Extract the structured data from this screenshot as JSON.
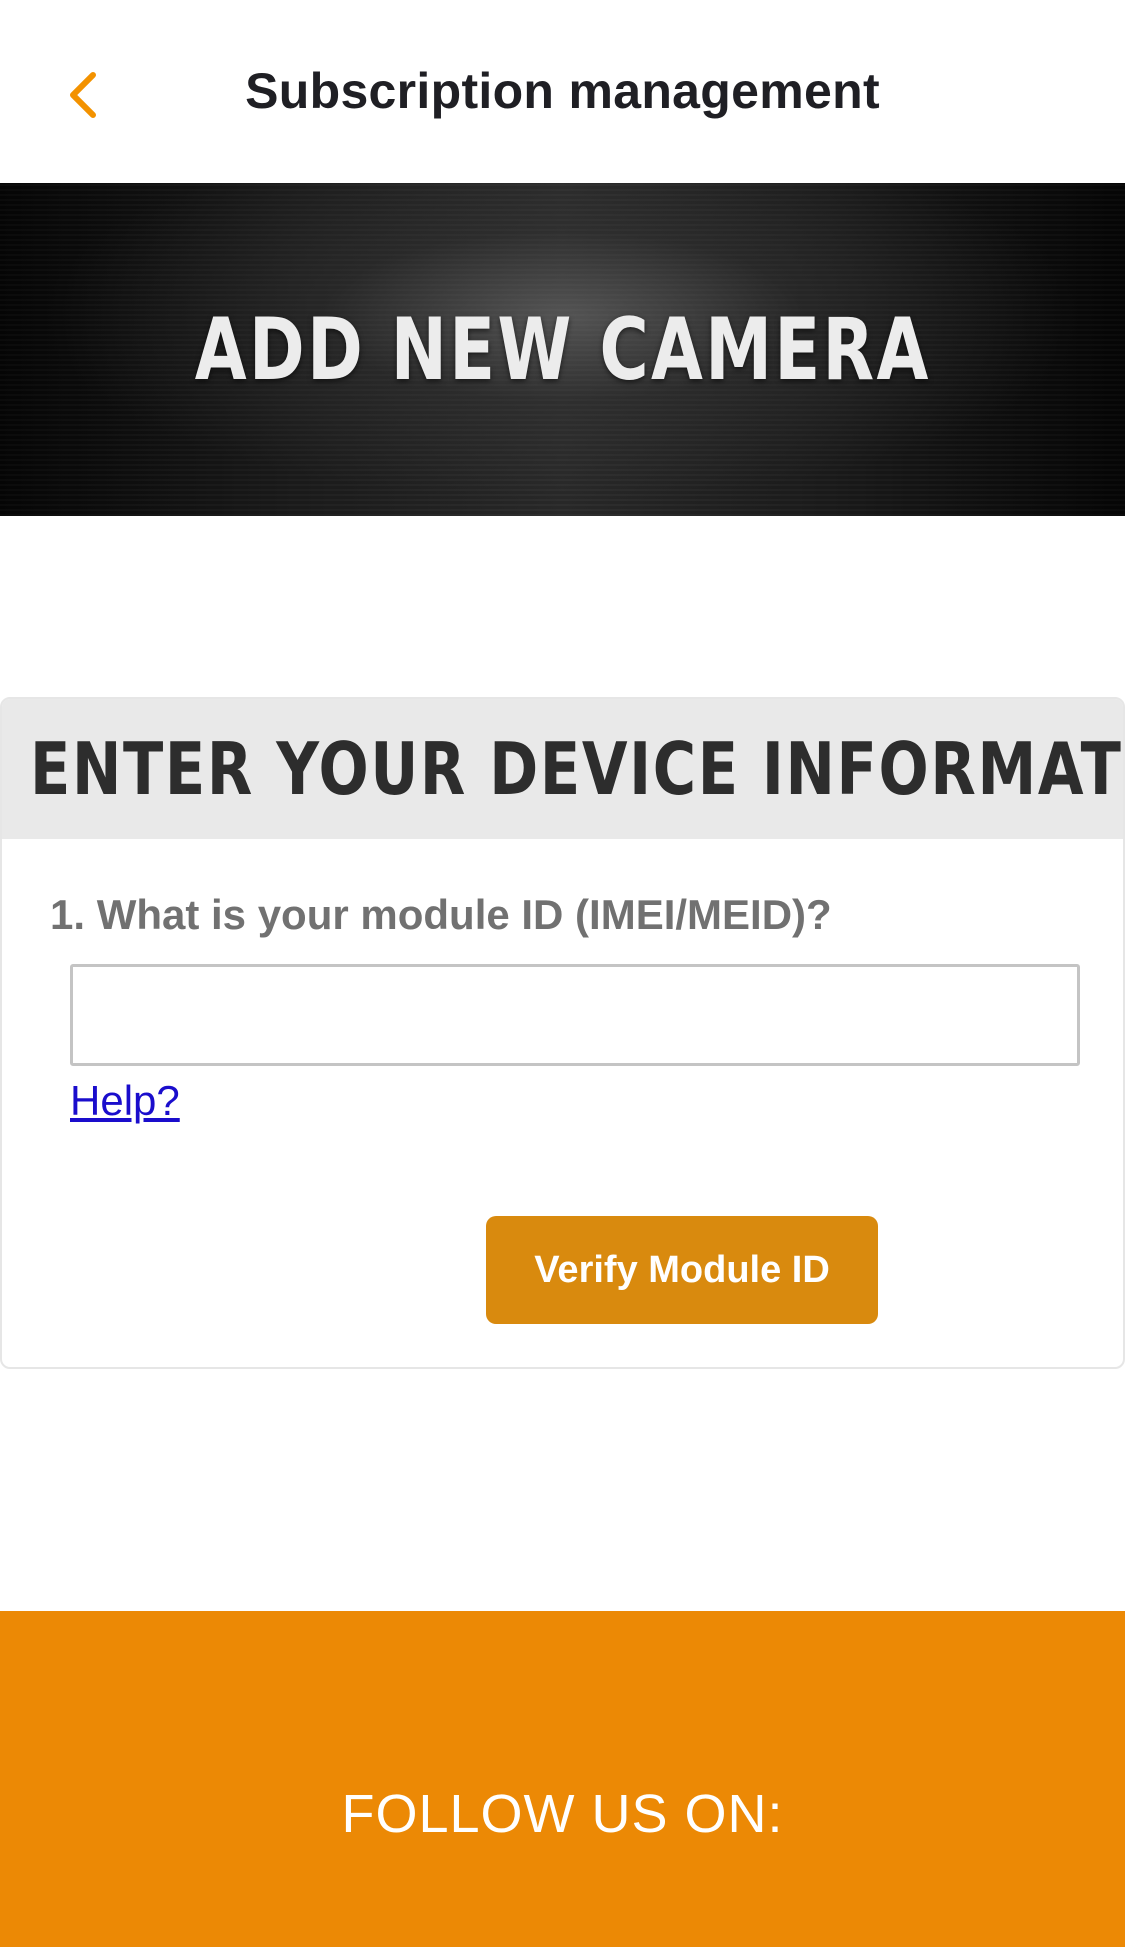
{
  "header": {
    "title": "Subscription management",
    "back_icon": "chevron-left-icon",
    "accent_color": "#F39200"
  },
  "hero": {
    "title": "ADD NEW CAMERA"
  },
  "device_form": {
    "heading": "ENTER YOUR DEVICE INFORMATION",
    "question": "1. What is your module ID (IMEI/MEID)?",
    "module_id_value": "",
    "help_link": "Help?",
    "verify_button": "Verify Module ID",
    "button_color": "#D98A0E"
  },
  "footer": {
    "follow_label": "FOLLOW US ON:",
    "background_color": "#EC8905"
  }
}
